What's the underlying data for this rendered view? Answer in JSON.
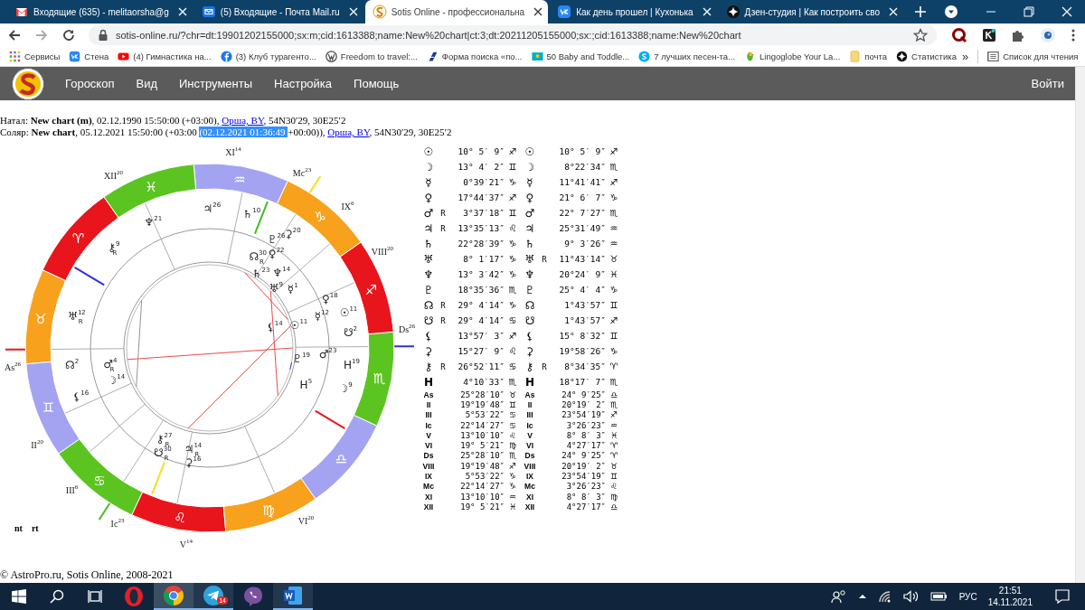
{
  "browser": {
    "tabs": [
      {
        "title": "Входящие (635) - melitaorsha@g",
        "selected": false
      },
      {
        "title": "(5) Входящие - Почта Mail.ru",
        "selected": false
      },
      {
        "title": "Sotis Online - профессиональна",
        "selected": true
      },
      {
        "title": "Как день прошел | Кухонька",
        "selected": false
      },
      {
        "title": "Дзен-студия | Как построить сво",
        "selected": false
      }
    ],
    "url": "sotis-online.ru/?chr=dt:19901202155000;sx:m;cid:1613388;name:New%20chart|ct:3;dt:20211205155000;sx:;cid:1613388;name:New%20chart",
    "bookmarks": [
      "Сервисы",
      "Стена",
      "(4) Гимнастика на...",
      "(3) Клуб турагенто...",
      "Freedom to travel:...",
      "Форма поиска «по...",
      "50 Baby and Toddle...",
      "7 лучших песен-та...",
      "Lingoglobe Your La...",
      "почта",
      "Статистика"
    ],
    "more": "»",
    "reading_list": "Список для чтения"
  },
  "site": {
    "menu": [
      "Гороскоп",
      "Вид",
      "Инструменты",
      "Настройка",
      "Помощь"
    ],
    "login": "Войти"
  },
  "info": [
    [
      {
        "kind": "text",
        "text": "Натал: **New chart (m)**, 02.12.1990 15:50:00 (+03:00), "
      },
      {
        "kind": "link",
        "text": "Орша, BY"
      },
      {
        "kind": "text",
        "text": ", 54N30′29, 30E25′2"
      }
    ],
    [
      {
        "kind": "text",
        "text": "Соляр: **New chart**, 05.12.2021 15:50:00 (+03:00 "
      },
      {
        "kind": "selection",
        "text": "(02.12.2021 01:36:49 "
      },
      {
        "kind": "text",
        "text": "+00:00)), "
      },
      {
        "kind": "link",
        "text": "Орша, BY"
      },
      {
        "kind": "text",
        "text": ", 54N30′29, 30E25′2"
      }
    ]
  ],
  "wheel": {
    "zodiac": [
      {
        "glyph": "♈",
        "color": "#e8161c"
      },
      {
        "glyph": "♉",
        "color": "#f7a11d"
      },
      {
        "glyph": "♊",
        "color": "#a4a3f2"
      },
      {
        "glyph": "♋",
        "color": "#5cc421"
      },
      {
        "glyph": "♌",
        "color": "#e8161c"
      },
      {
        "glyph": "♍",
        "color": "#f7a11d"
      },
      {
        "glyph": "♎",
        "color": "#a4a3f2"
      },
      {
        "glyph": "♏",
        "color": "#5cc421"
      },
      {
        "glyph": "♐",
        "color": "#e8161c"
      },
      {
        "glyph": "♑",
        "color": "#f7a11d"
      },
      {
        "glyph": "♒",
        "color": "#a4a3f2"
      },
      {
        "glyph": "♓",
        "color": "#5cc421"
      }
    ],
    "house_labels": [
      {
        "label": "XI",
        "degree": "14"
      },
      {
        "label": "XII",
        "degree": "20"
      },
      {
        "label": "Mc",
        "degree": "23"
      },
      {
        "label": "IX",
        "degree": "6"
      },
      {
        "label": "VIII",
        "degree": "20"
      },
      {
        "label": "Ds",
        "degree": "26"
      },
      {
        "label": "As",
        "degree": "26"
      },
      {
        "label": "II",
        "degree": "20"
      },
      {
        "label": "VI",
        "degree": "20"
      },
      {
        "label": "III",
        "degree": "6"
      },
      {
        "label": "Ic",
        "degree": "23"
      },
      {
        "label": "V",
        "degree": "14"
      }
    ],
    "natal_planets": [
      {
        "glyph": "☊",
        "degree": "30",
        "retro": "R"
      },
      {
        "glyph": "♄",
        "degree": "23"
      },
      {
        "glyph": "♆",
        "degree": "14"
      },
      {
        "glyph": "♅",
        "degree": "9"
      },
      {
        "glyph": "☿",
        "degree": "1"
      },
      {
        "glyph": "♀",
        "degree": "18"
      },
      {
        "glyph": "⚸",
        "degree": "14"
      },
      {
        "glyph": "☉",
        "degree": "11"
      },
      {
        "glyph": "♇",
        "degree": "19"
      },
      {
        "glyph": "♂",
        "degree": "4",
        "retro": "R"
      },
      {
        "glyph": "☽",
        "degree": "14"
      },
      {
        "glyph": "H",
        "degree": "5"
      },
      {
        "glyph": "⚷",
        "degree": "27",
        "retro": "R"
      },
      {
        "glyph": "☋",
        "degree": "30",
        "retro": "R"
      },
      {
        "glyph": "♃",
        "degree": "14",
        "retro": "R"
      },
      {
        "glyph": "⚳",
        "degree": "16"
      }
    ],
    "solar_planets": [
      {
        "glyph": "♃",
        "degree": "26"
      },
      {
        "glyph": "♄",
        "degree": "10"
      },
      {
        "glyph": "♆",
        "degree": "21"
      },
      {
        "glyph": "♇",
        "degree": "26"
      },
      {
        "glyph": "♀",
        "degree": "22"
      },
      {
        "glyph": "⚳",
        "degree": "20"
      },
      {
        "glyph": "⚷",
        "degree": "9",
        "retro": "R"
      },
      {
        "glyph": "☿",
        "degree": "12"
      },
      {
        "glyph": "☉",
        "degree": "11"
      },
      {
        "glyph": "♅",
        "degree": "12",
        "retro": "R"
      },
      {
        "glyph": "☋",
        "degree": "2"
      },
      {
        "glyph": "♂",
        "degree": "23"
      },
      {
        "glyph": "☊",
        "degree": "2"
      },
      {
        "glyph": "H",
        "degree": "19"
      },
      {
        "glyph": "☽",
        "degree": "9"
      },
      {
        "glyph": "⚸",
        "degree": "16"
      }
    ],
    "legend": [
      "nt",
      "rt"
    ]
  },
  "table": {
    "rows": [
      {
        "kind": "planet",
        "natal": {
          "glyph": "☉",
          "position": "10° 5′ 9″",
          "sign": "♐"
        },
        "solar": {
          "glyph": "☉",
          "position": "10° 5′ 9″",
          "sign": "♐"
        }
      },
      {
        "kind": "planet",
        "natal": {
          "glyph": "☽",
          "position": "13° 4′ 2″",
          "sign": "♊"
        },
        "solar": {
          "glyph": "☽",
          "position": "8°22′34″",
          "sign": "♏"
        }
      },
      {
        "kind": "planet",
        "natal": {
          "glyph": "☿",
          "position": "0°39′21″",
          "sign": "♑"
        },
        "solar": {
          "glyph": "☿",
          "position": "11°41′41″",
          "sign": "♐"
        }
      },
      {
        "kind": "planet",
        "natal": {
          "glyph": "♀",
          "position": "17°44′37″",
          "sign": "♐"
        },
        "solar": {
          "glyph": "♀",
          "position": "21° 6′ 7″",
          "sign": "♑"
        }
      },
      {
        "kind": "planet",
        "natal": {
          "glyph": "♂",
          "retro": "R",
          "position": "3°37′18″",
          "sign": "♊"
        },
        "solar": {
          "glyph": "♂",
          "position": "22° 7′27″",
          "sign": "♏"
        }
      },
      {
        "kind": "planet",
        "natal": {
          "glyph": "♃",
          "retro": "R",
          "position": "13°35′13″",
          "sign": "♌"
        },
        "solar": {
          "glyph": "♃",
          "position": "25°31′49″",
          "sign": "♒"
        }
      },
      {
        "kind": "planet",
        "natal": {
          "glyph": "♄",
          "position": "22°28′39″",
          "sign": "♑"
        },
        "solar": {
          "glyph": "♄",
          "position": "9° 3′26″",
          "sign": "♒"
        }
      },
      {
        "kind": "planet",
        "natal": {
          "glyph": "♅",
          "position": "8° 1′17″",
          "sign": "♑"
        },
        "solar": {
          "glyph": "♅",
          "retro": "R",
          "position": "11°43′14″",
          "sign": "♉"
        }
      },
      {
        "kind": "planet",
        "natal": {
          "glyph": "♆",
          "position": "13° 3′42″",
          "sign": "♑"
        },
        "solar": {
          "glyph": "♆",
          "position": "20°24′ 9″",
          "sign": "♓"
        }
      },
      {
        "kind": "planet",
        "natal": {
          "glyph": "♇",
          "position": "18°35′36″",
          "sign": "♏"
        },
        "solar": {
          "glyph": "♇",
          "position": "25° 4′ 4″",
          "sign": "♑"
        }
      },
      {
        "kind": "planet",
        "natal": {
          "glyph": "☊",
          "retro": "R",
          "position": "29° 4′14″",
          "sign": "♑"
        },
        "solar": {
          "glyph": "☊",
          "position": "1°43′57″",
          "sign": "♊"
        }
      },
      {
        "kind": "planet",
        "natal": {
          "glyph": "☋",
          "retro": "R",
          "position": "29° 4′14″",
          "sign": "♋"
        },
        "solar": {
          "glyph": "☋",
          "position": "1°43′57″",
          "sign": "♐"
        }
      },
      {
        "kind": "planet",
        "natal": {
          "glyph": "⚸",
          "position": "13°57′ 3″",
          "sign": "♐"
        },
        "solar": {
          "glyph": "⚸",
          "position": "15° 8′32″",
          "sign": "♊"
        }
      },
      {
        "kind": "planet",
        "natal": {
          "glyph": "⚳",
          "position": "15°27′ 9″",
          "sign": "♌"
        },
        "solar": {
          "glyph": "⚳",
          "position": "19°58′26″",
          "sign": "♑"
        }
      },
      {
        "kind": "planet",
        "natal": {
          "glyph": "⚷",
          "retro": "R",
          "position": "26°52′11″",
          "sign": "♋"
        },
        "solar": {
          "glyph": "⚷",
          "retro": "R",
          "position": "8°34′35″",
          "sign": "♈"
        }
      },
      {
        "kind": "planet",
        "natal": {
          "glyph": "H",
          "position": "4°10′33″",
          "sign": "♏"
        },
        "solar": {
          "glyph": "H",
          "position": "18°17′ 7″",
          "sign": "♏"
        }
      },
      {
        "kind": "house",
        "natal": {
          "glyph": "As",
          "position": "25°28′10″",
          "sign": "♉"
        },
        "solar": {
          "glyph": "As",
          "position": "24° 9′25″",
          "sign": "♎"
        }
      },
      {
        "kind": "house",
        "natal": {
          "glyph": "II",
          "position": "19°19′48″",
          "sign": "♊"
        },
        "solar": {
          "glyph": "II",
          "position": "20°19′ 2″",
          "sign": "♏"
        }
      },
      {
        "kind": "house",
        "natal": {
          "glyph": "III",
          "position": "5°53′22″",
          "sign": "♋"
        },
        "solar": {
          "glyph": "III",
          "position": "23°54′19″",
          "sign": "♐"
        }
      },
      {
        "kind": "house",
        "natal": {
          "glyph": "Ic",
          "position": "22°14′27″",
          "sign": "♋"
        },
        "solar": {
          "glyph": "Ic",
          "position": "3°26′23″",
          "sign": "♒"
        }
      },
      {
        "kind": "house",
        "natal": {
          "glyph": "V",
          "position": "13°10′10″",
          "sign": "♌"
        },
        "solar": {
          "glyph": "V",
          "position": "8° 8′ 3″",
          "sign": "♓"
        }
      },
      {
        "kind": "house",
        "natal": {
          "glyph": "VI",
          "position": "19° 5′21″",
          "sign": "♍"
        },
        "solar": {
          "glyph": "VI",
          "position": "4°27′17″",
          "sign": "♈"
        }
      },
      {
        "kind": "house",
        "natal": {
          "glyph": "Ds",
          "position": "25°28′10″",
          "sign": "♏"
        },
        "solar": {
          "glyph": "Ds",
          "position": "24° 9′25″",
          "sign": "♈"
        }
      },
      {
        "kind": "house",
        "natal": {
          "glyph": "VIII",
          "position": "19°19′48″",
          "sign": "♐"
        },
        "solar": {
          "glyph": "VIII",
          "position": "20°19′ 2″",
          "sign": "♉"
        }
      },
      {
        "kind": "house",
        "natal": {
          "glyph": "IX",
          "position": "5°53′22″",
          "sign": "♑"
        },
        "solar": {
          "glyph": "IX",
          "position": "23°54′19″",
          "sign": "♊"
        }
      },
      {
        "kind": "house",
        "natal": {
          "glyph": "Mc",
          "position": "22°14′27″",
          "sign": "♑"
        },
        "solar": {
          "glyph": "Mc",
          "position": "3°26′23″",
          "sign": "♌"
        }
      },
      {
        "kind": "house",
        "natal": {
          "glyph": "XI",
          "position": "13°10′10″",
          "sign": "♒"
        },
        "solar": {
          "glyph": "XI",
          "position": "8° 8′ 3″",
          "sign": "♍"
        }
      },
      {
        "kind": "house",
        "natal": {
          "glyph": "XII",
          "position": "19° 5′21″",
          "sign": "♓"
        },
        "solar": {
          "glyph": "XII",
          "position": "4°27′17″",
          "sign": "♎"
        }
      }
    ]
  },
  "footer": "© AstroPro.ru, Sotis Online, 2008-2021",
  "taskbar": {
    "apps": [
      {
        "kind": "opera",
        "active": false,
        "running": false
      },
      {
        "kind": "chrome",
        "active": true,
        "running": true
      },
      {
        "kind": "telegram",
        "active": false,
        "running": true,
        "badge": "14"
      },
      {
        "kind": "viber",
        "active": false,
        "running": false
      },
      {
        "kind": "word",
        "active": false,
        "running": true
      }
    ],
    "language": "РУС",
    "time": "21:51",
    "date": "14.11.2021"
  }
}
